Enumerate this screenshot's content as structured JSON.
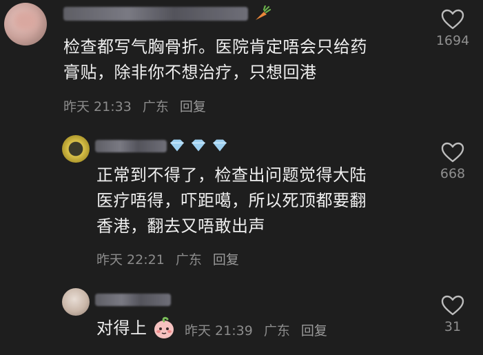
{
  "comments": [
    {
      "text_lines": [
        "检查都写气胸骨折。医院肯定唔会只给药",
        "膏贴，除非你不想治疗，只想回港"
      ],
      "time": "昨天 21:33",
      "location": "广东",
      "reply_label": "回复",
      "likes": "1694",
      "username_emoji_icon": "carrot-icon"
    },
    {
      "text_lines": [
        "正常到不得了，检查出问题觉得大陆",
        "医疗唔得，吓距噶，所以死顶都要翻",
        "香港，翻去又唔敢出声"
      ],
      "time": "昨天 22:21",
      "location": "广东",
      "reply_label": "回复",
      "likes": "668",
      "username_badge_icon": "diamond-icon"
    },
    {
      "text": "对得上",
      "sticker_icon": "peach-face-sticker-icon",
      "time": "昨天 21:39",
      "location": "广东",
      "reply_label": "回复",
      "likes": "31"
    }
  ]
}
